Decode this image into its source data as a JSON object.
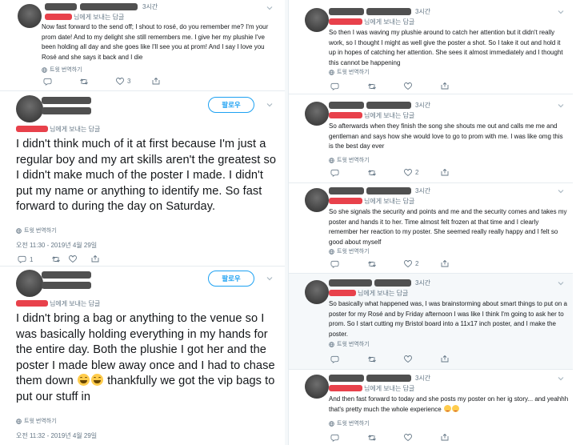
{
  "labels": {
    "replying_to": "님에게 보내는 답글",
    "translate": "트윗 번역하기",
    "follow": "팔로우",
    "time_3h": "3시간"
  },
  "left": {
    "t1": {
      "time": "3시간",
      "text": "Now fast forward to the send off; I shout to rosé, do you remember me? I'm your prom date! And to my delight she still remembers me. I give her my plushie I've been holding all day and she goes like I'll see you at prom! And I say I love you Rosé and she says it back and I die",
      "like_count": "3"
    },
    "t2": {
      "text": "I didn't think much of it at first because I'm just a regular boy and my art skills aren't the greatest so I didn't make much of the poster I made. I didn't put my name or anything to identify me. So fast forward to during the day on Saturday.",
      "date": "오전 11:30 - 2019년 4월 29일",
      "reply_count": "1"
    },
    "t3": {
      "text": "I didn't bring a bag or anything to the venue so I was basically holding everything in my hands for the entire day. Both the plushie I got her and the poster I made blew away once and I had to chase them down",
      "text_end": "thankfully we got the vip bags to put our stuff in",
      "date": "오전 11:32 - 2019년 4월 29일"
    }
  },
  "right": {
    "r1": {
      "text": "So then I was waving my plushie around to catch her attention but it didn't really work, so I thought I might as well give the poster a shot. So I take it out and hold it up in hopes of catching her attention. She sees it almost immediately and I thought this cannot be happening"
    },
    "r2": {
      "text": "So afterwards when they finish the song she shouts me out and calls me me and gentleman and says how she would love to go to prom with me. I was like omg this is the best day ever",
      "like_count": "2"
    },
    "r3": {
      "text": "So she signals the security and points and me and the security comes and takes my poster and hands it to her. Time almost felt frozen at that time and I clearly remember her reaction to my poster. She seemed really really happy and I felt so good about myself",
      "like_count": "2"
    },
    "r4": {
      "text": "So basically what happened was, I was brainstorming about smart things to put on a poster for my Rosé and by Friday afternoon I was like I think I'm going to ask her to prom. So I start cutting my Bristol board into a 11x17 inch poster, and I make the poster."
    },
    "r5": {
      "text": "And then fast forward to today and she posts my poster on her ig story... and yeahhh that's pretty much the whole experience"
    }
  },
  "colors": {
    "accent": "#1da1f2",
    "redaction_name": "#505050",
    "redaction_handle": "#e8414b",
    "emoji": "#ffcc4d"
  },
  "icons": [
    "reply-icon",
    "retweet-icon",
    "like-icon",
    "globe-icon",
    "chevron-down-icon",
    "laughing-tears-emoji",
    "blushing-emoji"
  ]
}
